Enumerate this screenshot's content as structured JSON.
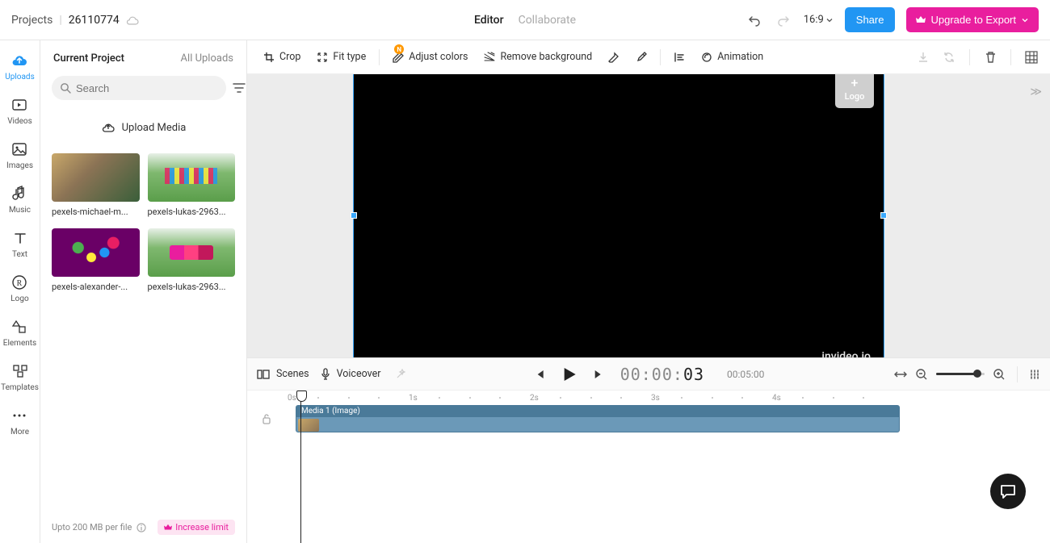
{
  "breadcrumb": {
    "root": "Projects",
    "id": "26110774"
  },
  "topTabs": {
    "editor": "Editor",
    "collaborate": "Collaborate"
  },
  "aspect": "16:9",
  "buttons": {
    "share": "Share",
    "upgrade": "Upgrade to Export"
  },
  "leftnav": {
    "uploads": "Uploads",
    "videos": "Videos",
    "images": "Images",
    "music": "Music",
    "text": "Text",
    "logo": "Logo",
    "elements": "Elements",
    "templates": "Templates",
    "more": "More"
  },
  "mediaPanel": {
    "tabCurrent": "Current Project",
    "tabAll": "All Uploads",
    "searchPlaceholder": "Search",
    "uploadBtn": "Upload Media",
    "thumbs": {
      "a": "pexels-michael-m...",
      "b": "pexels-lukas-2963...",
      "c": "pexels-alexander-...",
      "d": "pexels-lukas-2963..."
    },
    "footer": "Upto 200 MB per file",
    "increase": "Increase limit"
  },
  "toolbar": {
    "crop": "Crop",
    "fit": "Fit type",
    "adjust": "Adjust colors",
    "removebg": "Remove background",
    "animation": "Animation",
    "badgeN": "N"
  },
  "canvas": {
    "logo": "Logo",
    "watermark": "invideo.io"
  },
  "playbar": {
    "scenes": "Scenes",
    "voiceover": "Voiceover",
    "tc_pre": "00:00:",
    "tc_emph": "03",
    "duration": "00:05:00"
  },
  "timeline": {
    "clipTitle": "Media 1 (Image)",
    "ticks": {
      "t0": "0s",
      "t1": "1s",
      "t2": "2s",
      "t3": "3s",
      "t4": "4s"
    }
  }
}
